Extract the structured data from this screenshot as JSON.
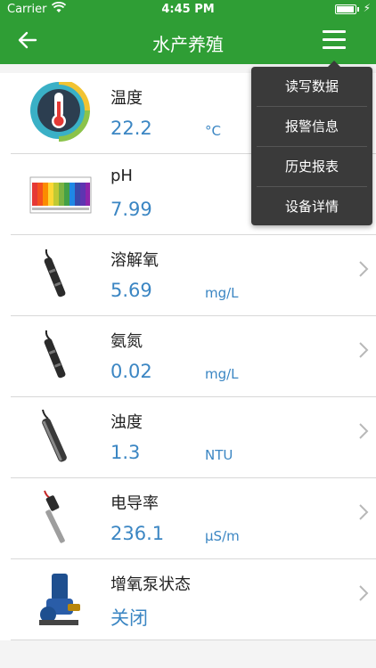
{
  "status_bar": {
    "carrier": "Carrier",
    "time": "4:45 PM",
    "battery_level": 0.95
  },
  "navbar": {
    "title": "水产养殖"
  },
  "sensors": [
    {
      "name": "温度",
      "value": "22.2",
      "unit": "°C",
      "icon": "thermometer-gauge-icon"
    },
    {
      "name": "pH",
      "value": "7.99",
      "unit": "",
      "icon": "ph-color-chart-icon"
    },
    {
      "name": "溶解氧",
      "value": "5.69",
      "unit": "mg/L",
      "icon": "probe-sensor-icon"
    },
    {
      "name": "氨氮",
      "value": "0.02",
      "unit": "mg/L",
      "icon": "probe-sensor-icon"
    },
    {
      "name": "浊度",
      "value": "1.3",
      "unit": "NTU",
      "icon": "turbidity-probe-icon"
    },
    {
      "name": "电导率",
      "value": "236.1",
      "unit": "µS/m",
      "icon": "conductivity-probe-icon"
    },
    {
      "name": "增氧泵状态",
      "value": "关闭",
      "unit": "",
      "icon": "aerator-pump-icon"
    }
  ],
  "menu": {
    "items": [
      "读写数据",
      "报警信息",
      "历史报表",
      "设备详情"
    ]
  },
  "colors": {
    "primary": "#2f9e35",
    "value_blue": "#3b86c3",
    "menu_bg": "#3a3a3a"
  }
}
